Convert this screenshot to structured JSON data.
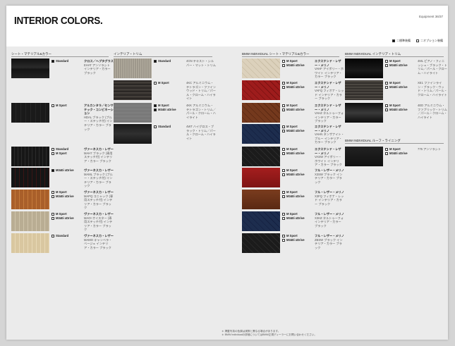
{
  "page": {
    "title": "INTERIOR COLORS.",
    "page_ref": "Equipment  36/37",
    "legend": {
      "standard": "＝標準装備",
      "option": "＝オプション装備"
    },
    "footnote": [
      "＊ 掲載写真の色調は実際と異なる場合があります。",
      "＊ BMW Individualの詳細についてはBMW正規ディーラーにお問い合わせください。"
    ]
  },
  "sections": {
    "seat": "シート・マテリアル&カラー",
    "trim": "インテリア・トリム",
    "ind_seat": "BMW INDIVIDUAL シート・マテリアル&カラー",
    "ind_trim": "BMW INDIVIDUAL インテリア・トリム",
    "ind_roof": "BMW INDIVIDUAL ルーフ・ライニング"
  },
  "seats": [
    {
      "options": [
        {
          "type": "filled",
          "label": "Standard"
        }
      ],
      "name": "クロス／ヘプタグラス",
      "desc": "EHAT アンソラシト インテリア・カラー ブラック",
      "swatch": "t-black"
    },
    {
      "options": [
        {
          "type": "empty",
          "label": "M Sport"
        }
      ],
      "name": "アルカンタラ／センサテック・コンビネーション",
      "desc": "HDAL ブラック (ブルー・ステッチ付) インテリア・カラー ブラック",
      "swatch": "t-black2"
    },
    {
      "options": [
        {
          "type": "empty",
          "label": "Standard"
        },
        {
          "type": "empty",
          "label": "M Sport"
        }
      ],
      "name": "ヴァーネスカ・レザー",
      "desc": "MAH7 ブラック (専用ステッチ付) インテリア・カラー ブラック",
      "swatch": "t-stitch-black"
    },
    {
      "options": [
        {
          "type": "filled",
          "label": "M340i xDrive"
        }
      ],
      "name": "ヴァーネスカ・レザー",
      "desc": "MAML ブラック (ブルー・ステッチ付) インテリア・カラー ブラック",
      "swatch": "t-black-red"
    },
    {
      "options": [
        {
          "type": "empty",
          "label": "M Sport"
        },
        {
          "type": "empty",
          "label": "M340i xDrive"
        }
      ],
      "name": "ヴァーネスカ・レザー",
      "desc": "MAPQ コニャック (専用ステッチ付) インテリア・カラー ブラック",
      "swatch": "t-cognac"
    },
    {
      "options": [
        {
          "type": "empty",
          "label": "M Sport"
        },
        {
          "type": "empty",
          "label": "M340i xDrive"
        }
      ],
      "name": "ヴァーネスカ・レザー",
      "desc": "MAOI オイスター (専用ステッチ付) インテリア・カラー ブラック",
      "swatch": "t-oyster"
    },
    {
      "options": [
        {
          "type": "empty",
          "label": "Standard"
        }
      ],
      "name": "ヴァーネスカ・レザー",
      "desc": "MAMO キャンベラ・ベージュ インテリア・カラー ブラック",
      "swatch": "t-canberra"
    }
  ],
  "trims": [
    {
      "options": [
        {
          "type": "filled",
          "label": "Standard"
        }
      ],
      "desc": "4GN テキスト・シルバー・マット・トリム",
      "swatch": "t-alu"
    },
    {
      "options": [
        {
          "type": "empty",
          "label": "M Sport"
        }
      ],
      "desc": "4KC アルミニウム・テトラゴン・ファインウッド・トリム／パール・クローム・ハイライト",
      "swatch": "t-wood"
    },
    {
      "options": [
        {
          "type": "filled",
          "label": "M Sport"
        },
        {
          "type": "filled",
          "label": "M340i xDrive"
        }
      ],
      "desc": "4KK アルミニウム・テトラゴン・トリム／パール・クローム・ハイライト",
      "swatch": "t-mesh"
    },
    {
      "options": [
        {
          "type": "empty",
          "label": "Standard"
        }
      ],
      "desc": "4WT ハイグロス・ブラック・トリム／パール・クローム・ハイライト",
      "swatch": "t-carbon"
    }
  ],
  "ind_seats": [
    {
      "options": [
        {
          "type": "empty",
          "label": "M Sport"
        },
        {
          "type": "empty",
          "label": "M340i xDrive"
        }
      ],
      "name": "エクステンド・レザー・メリノ",
      "desc": "VAHF アイボリー・ホワイト インテリア・カラー ブラック",
      "swatch": "t-q-ivory"
    },
    {
      "options": [
        {
          "type": "empty",
          "label": "M Sport"
        },
        {
          "type": "empty",
          "label": "M340i xDrive"
        }
      ],
      "name": "エクステンド・レザー・メリノ",
      "desc": "VAFQ フィオナ・レッド インテリア・カラー ブラック",
      "swatch": "t-q-red"
    },
    {
      "options": [
        {
          "type": "empty",
          "label": "M Sport"
        },
        {
          "type": "empty",
          "label": "M340i xDrive"
        }
      ],
      "name": "エクステンド・レザー・メリノ",
      "desc": "VAHZ タルトゥーフォ インテリア・カラー ブラック",
      "swatch": "t-q-tartufo"
    },
    {
      "options": [
        {
          "type": "empty",
          "label": "M Sport"
        },
        {
          "type": "empty",
          "label": "M340i xDrive"
        }
      ],
      "name": "エクステンド・レザー・メリノ",
      "desc": "VAHN タンザナイト・ブルー インテリア・カラー ブラック",
      "swatch": "t-q-blue"
    },
    {
      "options": [
        {
          "type": "empty",
          "label": "M Sport"
        },
        {
          "type": "empty",
          "label": "M340i xDrive"
        }
      ],
      "name": "エクステンド・レザー・メリノ",
      "desc": "VASW アイボリー・ホワイト インテリア・カラー ブラック",
      "swatch": "t-q-black"
    },
    {
      "options": [
        {
          "type": "empty",
          "label": "M Sport"
        },
        {
          "type": "empty",
          "label": "M340i xDrive"
        }
      ],
      "name": "フル・レザー・メリノ",
      "desc": "X3SW ブラック インテリア・カラー ブラック",
      "swatch": "t-red-plain"
    },
    {
      "options": [
        {
          "type": "empty",
          "label": "M Sport"
        },
        {
          "type": "empty",
          "label": "M340i xDrive"
        }
      ],
      "name": "フル・レザー・メリノ",
      "desc": "X3FQ フィオナ・レッド インテリア・カラー ブラック",
      "swatch": "t-tartufo-plain"
    },
    {
      "options": [
        {
          "type": "empty",
          "label": "M Sport"
        },
        {
          "type": "empty",
          "label": "M340i xDrive"
        }
      ],
      "name": "フル・レザー・メリノ",
      "desc": "X3HZ タルトゥーフォ インテリア・カラー ブラック",
      "swatch": "t-q-blue"
    },
    {
      "options": [
        {
          "type": "empty",
          "label": "M Sport"
        },
        {
          "type": "empty",
          "label": "M340i xDrive"
        }
      ],
      "name": "フル・レザー・メリノ",
      "desc": "ZBSW ブラック インテリア・カラー ブラック",
      "swatch": "t-q-black"
    }
  ],
  "ind_trims": [
    {
      "options": [
        {
          "type": "empty",
          "label": "M Sport"
        },
        {
          "type": "empty",
          "label": "M340i xDrive"
        }
      ],
      "desc": "4ML ピアノ・フィニッシュ・ブラック・トリム／パール・クローム・ハイライト",
      "swatch": "t-piano"
    },
    {
      "options": [
        {
          "type": "empty",
          "label": "M Sport"
        },
        {
          "type": "empty",
          "label": "M340i xDrive"
        }
      ],
      "desc": "XE1 ファインライン・ブラック・ウッド・トリム／パール・クローム・ハイライト",
      "swatch": "t-fineline"
    },
    {
      "options": [
        {
          "type": "empty",
          "label": "M Sport"
        },
        {
          "type": "empty",
          "label": "M340i xDrive"
        }
      ],
      "desc": "4ED アルミニウム・ファブリック・トリム／パール・クローム・ハイライト",
      "swatch": "t-gloss"
    }
  ],
  "ind_roof": [
    {
      "options": [
        {
          "type": "empty",
          "label": "M Sport"
        },
        {
          "type": "empty",
          "label": "M340i xDrive"
        }
      ],
      "desc": "775 アンソラシト",
      "swatch": "t-alcantara"
    }
  ]
}
